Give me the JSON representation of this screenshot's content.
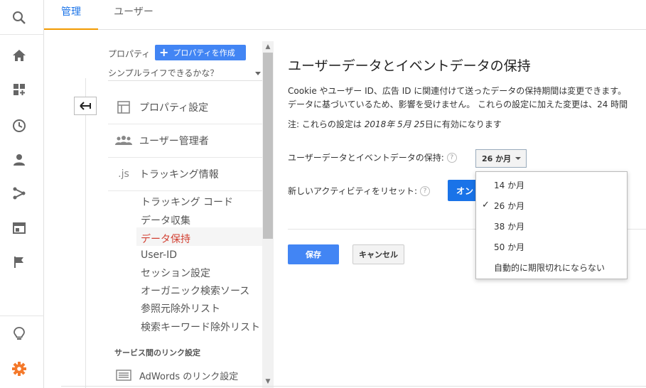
{
  "tabs": [
    {
      "label": "管理"
    },
    {
      "label": "ユーザー"
    }
  ],
  "nav": {
    "property_label": "プロパティ",
    "create_button": "プロパティを作成",
    "property_name": "シンプルライフできるかな？",
    "sections": [
      {
        "label": "プロパティ設定",
        "icon": "layout-icon"
      },
      {
        "label": "ユーザー管理者",
        "icon": "people-icon"
      },
      {
        "label": "トラッキング情報",
        "icon": "js-icon",
        "icon_text": ".js"
      }
    ],
    "sub_items": [
      {
        "label": "トラッキング コード"
      },
      {
        "label": "データ収集"
      },
      {
        "label": "データ保持"
      },
      {
        "label": "User-ID"
      },
      {
        "label": "セッション設定"
      },
      {
        "label": "オーガニック検索ソース"
      },
      {
        "label": "参照元除外リスト"
      },
      {
        "label": "検索キーワード除外リスト"
      }
    ],
    "group_label": "サービス間のリンク設定",
    "adwords_label": "AdWords のリンク設定"
  },
  "main": {
    "title": "ユーザーデータとイベントデータの保持",
    "desc_line1": "Cookie やユーザー ID、広告 ID に関連付けて送ったデータの保持期間は変更できます。",
    "desc_line2": "データに基づいているため、影響を受けません。 これらの設定に加えた変更は、24 時間",
    "note_prefix": "注: これらの設定は ",
    "note_date": "2018年 5月 25",
    "note_suffix": "日に有効になります",
    "retention_label": "ユーザーデータとイベントデータの保持:",
    "retention_value": "26 か月",
    "reset_label": "新しいアクティビティをリセット:",
    "reset_value": "オン",
    "help_glyph": "?",
    "save_label": "保存",
    "cancel_label": "キャンセル"
  },
  "dropdown": {
    "check_glyph": "✓",
    "options": [
      {
        "label": "14 か月",
        "selected": false
      },
      {
        "label": "26 か月",
        "selected": true
      },
      {
        "label": "38 か月",
        "selected": false
      },
      {
        "label": "50 か月",
        "selected": false
      },
      {
        "label": "自動的に期限切れにならない",
        "selected": false
      }
    ]
  },
  "colors": {
    "accent": "#1a73e8",
    "tab_underline": "#f29900",
    "selected_item": "#d23f31",
    "settings_gear": "#f4792b"
  }
}
